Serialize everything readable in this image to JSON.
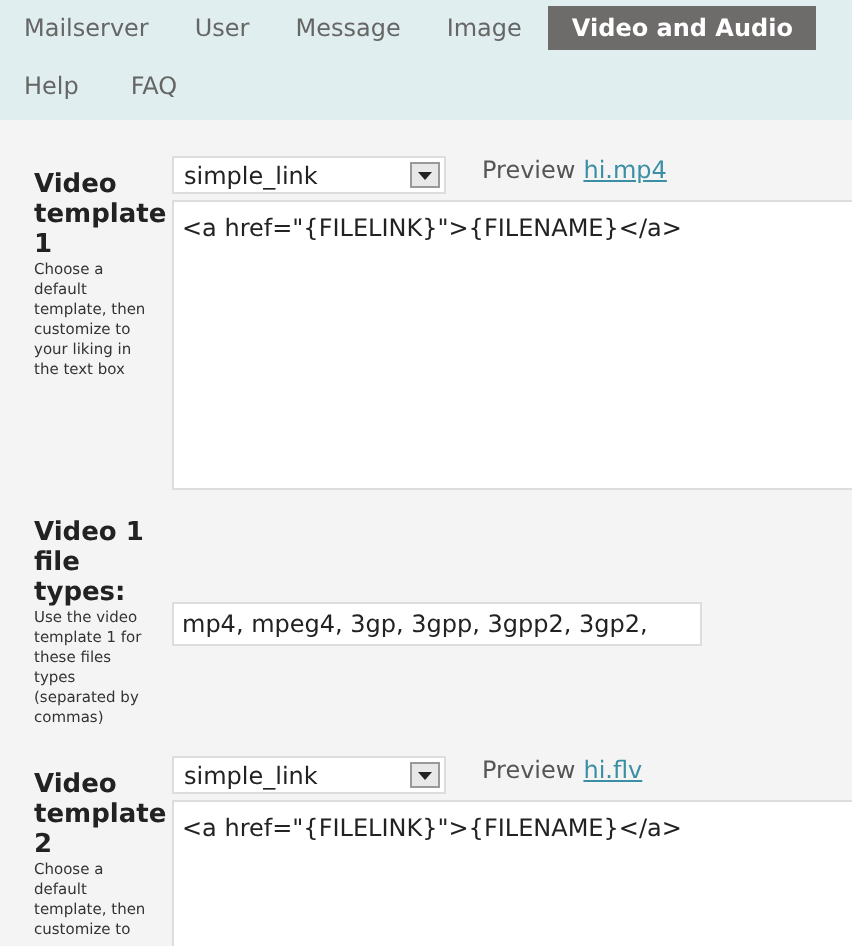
{
  "nav": {
    "tabs": [
      {
        "label": "Mailserver",
        "selected": false
      },
      {
        "label": "User",
        "selected": false
      },
      {
        "label": "Message",
        "selected": false
      },
      {
        "label": "Image",
        "selected": false
      },
      {
        "label": "Video and Audio",
        "selected": true
      }
    ],
    "links": [
      "Help",
      "FAQ"
    ]
  },
  "settings": [
    {
      "kind": "template",
      "title": "Video template 1",
      "description": "Choose a default template, then customize to your liking in the text box",
      "select_value": "simple_link",
      "preview_label": "Preview",
      "preview_link": "hi.mp4",
      "template_text": "<a href=\"{FILELINK}\">{FILENAME}</a>"
    },
    {
      "kind": "file_types",
      "title": "Video 1 file types:",
      "description": "Use the video template 1 for these files types (separated by commas)",
      "value": "mp4, mpeg4, 3gp, 3gpp, 3gpp2, 3gp2,"
    },
    {
      "kind": "template",
      "title": "Video template 2",
      "description": "Choose a default template, then customize to",
      "select_value": "simple_link",
      "preview_label": "Preview",
      "preview_link": "hi.flv",
      "template_text": "<a href=\"{FILELINK}\">{FILENAME}</a>"
    }
  ]
}
